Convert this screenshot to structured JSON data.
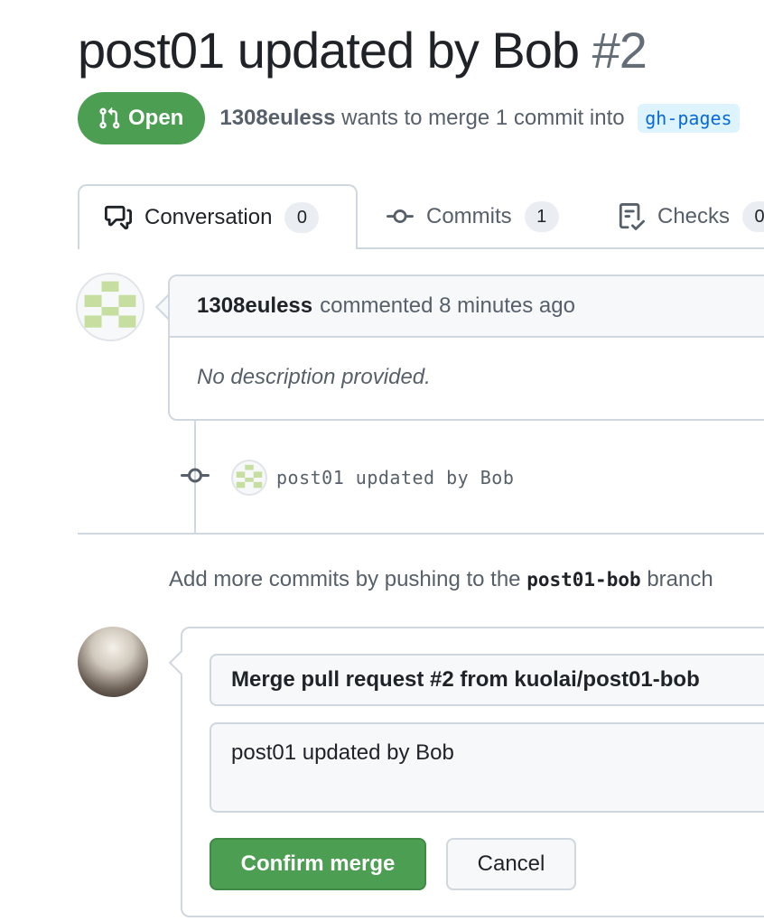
{
  "pr": {
    "title": "post01 updated by Bob",
    "number": "#2",
    "state": "Open",
    "author": "1308euless",
    "merge_text": "wants to merge 1 commit into",
    "base_branch": "gh-pages"
  },
  "tabs": [
    {
      "label": "Conversation",
      "count": "0",
      "icon": "comment-discussion-icon"
    },
    {
      "label": "Commits",
      "count": "1",
      "icon": "git-commit-icon"
    },
    {
      "label": "Checks",
      "count": "0",
      "icon": "checklist-icon"
    }
  ],
  "comment": {
    "author": "1308euless",
    "meta": "commented 8 minutes ago",
    "body": "No description provided."
  },
  "commit": {
    "message": "post01 updated by Bob"
  },
  "push_hint": {
    "before": "Add more commits by pushing to the",
    "branch": "post01-bob",
    "after": "branch"
  },
  "merge": {
    "title": "Merge pull request #2 from kuolai/post01-bob",
    "message": "post01 updated by Bob",
    "confirm_label": "Confirm merge",
    "cancel_label": "Cancel"
  },
  "colors": {
    "open_green": "#4c9f52",
    "link_blue": "#0969da",
    "border": "#d0d7de"
  }
}
